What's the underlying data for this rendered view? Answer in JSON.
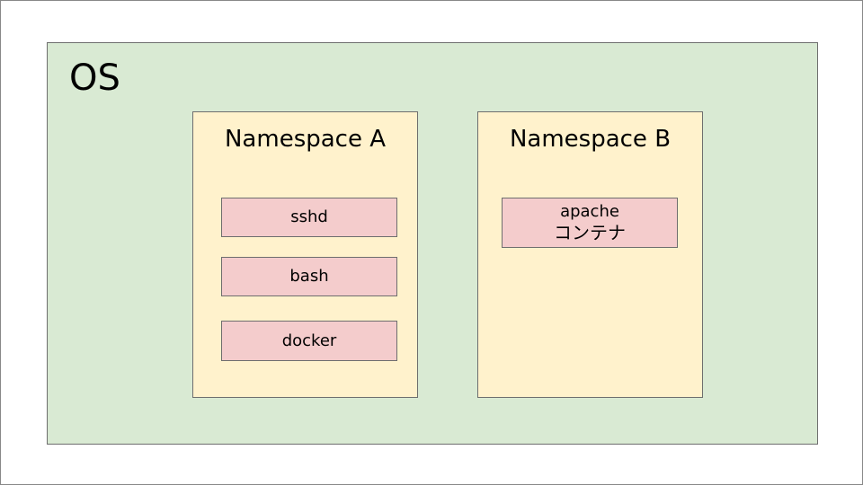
{
  "diagram": {
    "os": {
      "label": "OS"
    },
    "namespaces": [
      {
        "title": "Namespace A",
        "processes": [
          "sshd",
          "bash",
          "docker"
        ]
      },
      {
        "title": "Namespace B",
        "container": {
          "line1": "apache",
          "line2": "コンテナ"
        }
      }
    ]
  },
  "colors": {
    "os_fill": "#d9ead3",
    "namespace_fill": "#fff2cc",
    "process_fill": "#f4cccc",
    "border": "#6e6e6e"
  }
}
